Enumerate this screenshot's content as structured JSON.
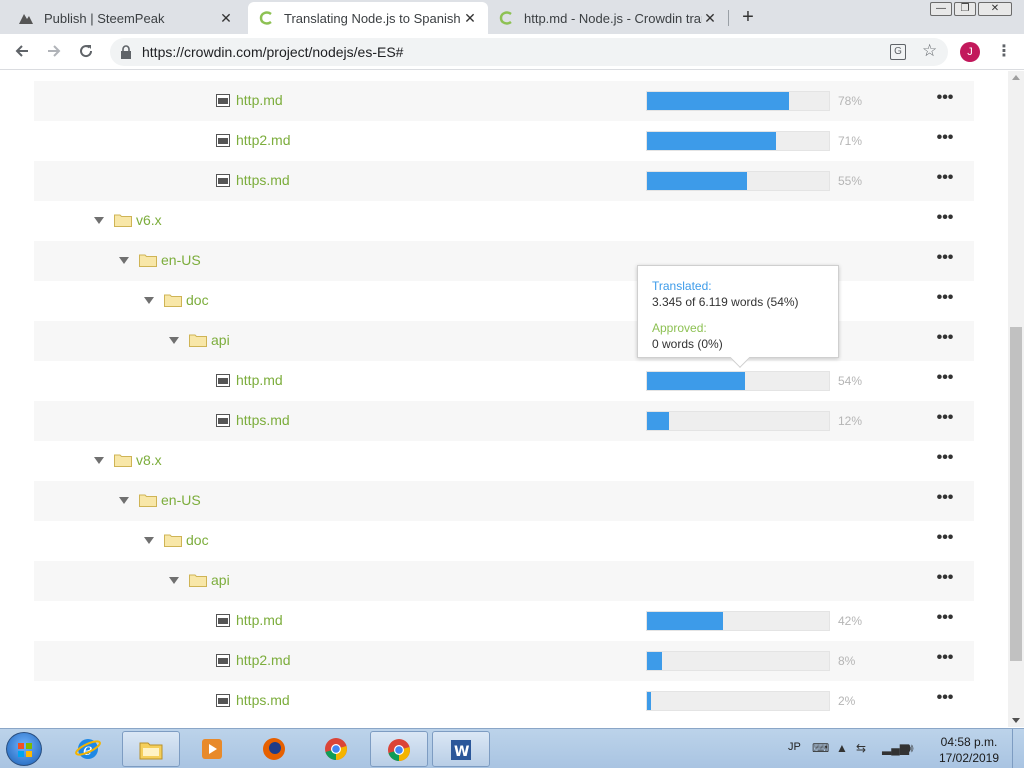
{
  "browser": {
    "tabs": [
      {
        "title": "Publish | SteemPeak",
        "close": "✕"
      },
      {
        "title": "Translating Node.js to Spanish la",
        "close": "✕"
      },
      {
        "title": "http.md - Node.js - Crowdin tran",
        "close": "✕"
      }
    ],
    "new_tab": "+",
    "window_controls": {
      "minimize": "—",
      "maximize": "❐",
      "close": "✕"
    },
    "url": "https://crowdin.com/project/nodejs/es-ES#",
    "avatar_initial": "J",
    "menu": "⋮"
  },
  "tree": {
    "rows": [
      {
        "name": "http.md",
        "percent": 78,
        "percent_label": "78%"
      },
      {
        "name": "http2.md",
        "percent": 71,
        "percent_label": "71%"
      },
      {
        "name": "https.md",
        "percent": 55,
        "percent_label": "55%"
      },
      {
        "name": "v6.x"
      },
      {
        "name": "en-US"
      },
      {
        "name": "doc"
      },
      {
        "name": "api"
      },
      {
        "name": "http.md",
        "percent": 54,
        "percent_label": "54%"
      },
      {
        "name": "https.md",
        "percent": 12,
        "percent_label": "12%"
      },
      {
        "name": "v8.x"
      },
      {
        "name": "en-US"
      },
      {
        "name": "doc"
      },
      {
        "name": "api"
      },
      {
        "name": "http.md",
        "percent": 42,
        "percent_label": "42%"
      },
      {
        "name": "http2.md",
        "percent": 8,
        "percent_label": "8%"
      },
      {
        "name": "https.md",
        "percent": 2,
        "percent_label": "2%"
      }
    ],
    "more_label": "•••"
  },
  "tooltip": {
    "translated_label": "Translated:",
    "translated_value": "3.345 of 6.119 words (54%)",
    "approved_label": "Approved:",
    "approved_value": "0 words (0%)"
  },
  "taskbar": {
    "language": "JP",
    "time": "04:58 p.m.",
    "date": "17/02/2019"
  },
  "colors": {
    "accent_green": "#7cad3c",
    "progress_blue": "#3d9be9",
    "approved_green": "#8dc153"
  }
}
